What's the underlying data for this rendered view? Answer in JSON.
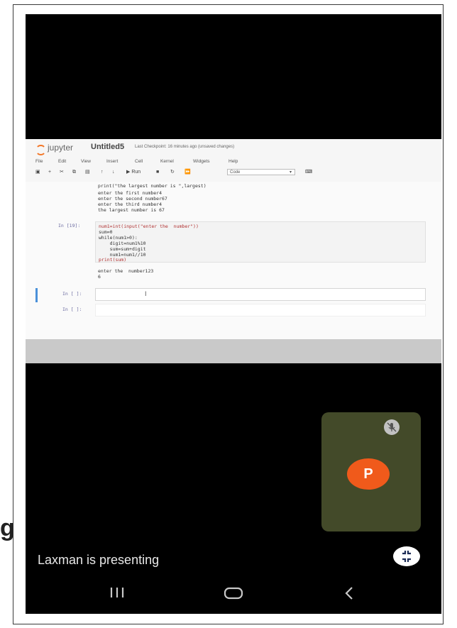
{
  "outer_mark": "g",
  "jupyter": {
    "logo_text": "jupyter",
    "notebook_name": "Untitled5",
    "checkpoint": "Last Checkpoint: 16 minutes ago  (unsaved changes)",
    "menu": [
      "File",
      "Edit",
      "View",
      "Insert",
      "Cell",
      "Kernel",
      "Widgets",
      "Help"
    ],
    "toolbar": {
      "run_label": "Run",
      "cell_type": "Code"
    },
    "output_lines": [
      "print(\"the largest number is \",largest)",
      "enter the first number4",
      "enter the second number67",
      "enter the third number4",
      "the largest number is 67"
    ],
    "cell_prompt": "In [19]:",
    "cell_code": [
      "num1=int(input(\"enter the  number\"))",
      "sum=0",
      "while(num1>0):",
      "    digit=num1%10",
      "    sum=sum+digit",
      "    num1=num1//10",
      "print(sum)"
    ],
    "cell_output": [
      "enter the  number123",
      "6"
    ],
    "empty_prompt_1": "In [ ]:",
    "empty_prompt_2": "In [ ]:"
  },
  "meeting": {
    "participant_initial": "P",
    "mic_state_icon": "mic-off-icon",
    "presenter_text": "Laxman is presenting",
    "avatar_color": "#f05a1b",
    "tile_color": "#434a29"
  },
  "navbar": {
    "recents_icon": "recents-icon",
    "home_icon": "home-icon",
    "back_icon": "back-icon"
  }
}
